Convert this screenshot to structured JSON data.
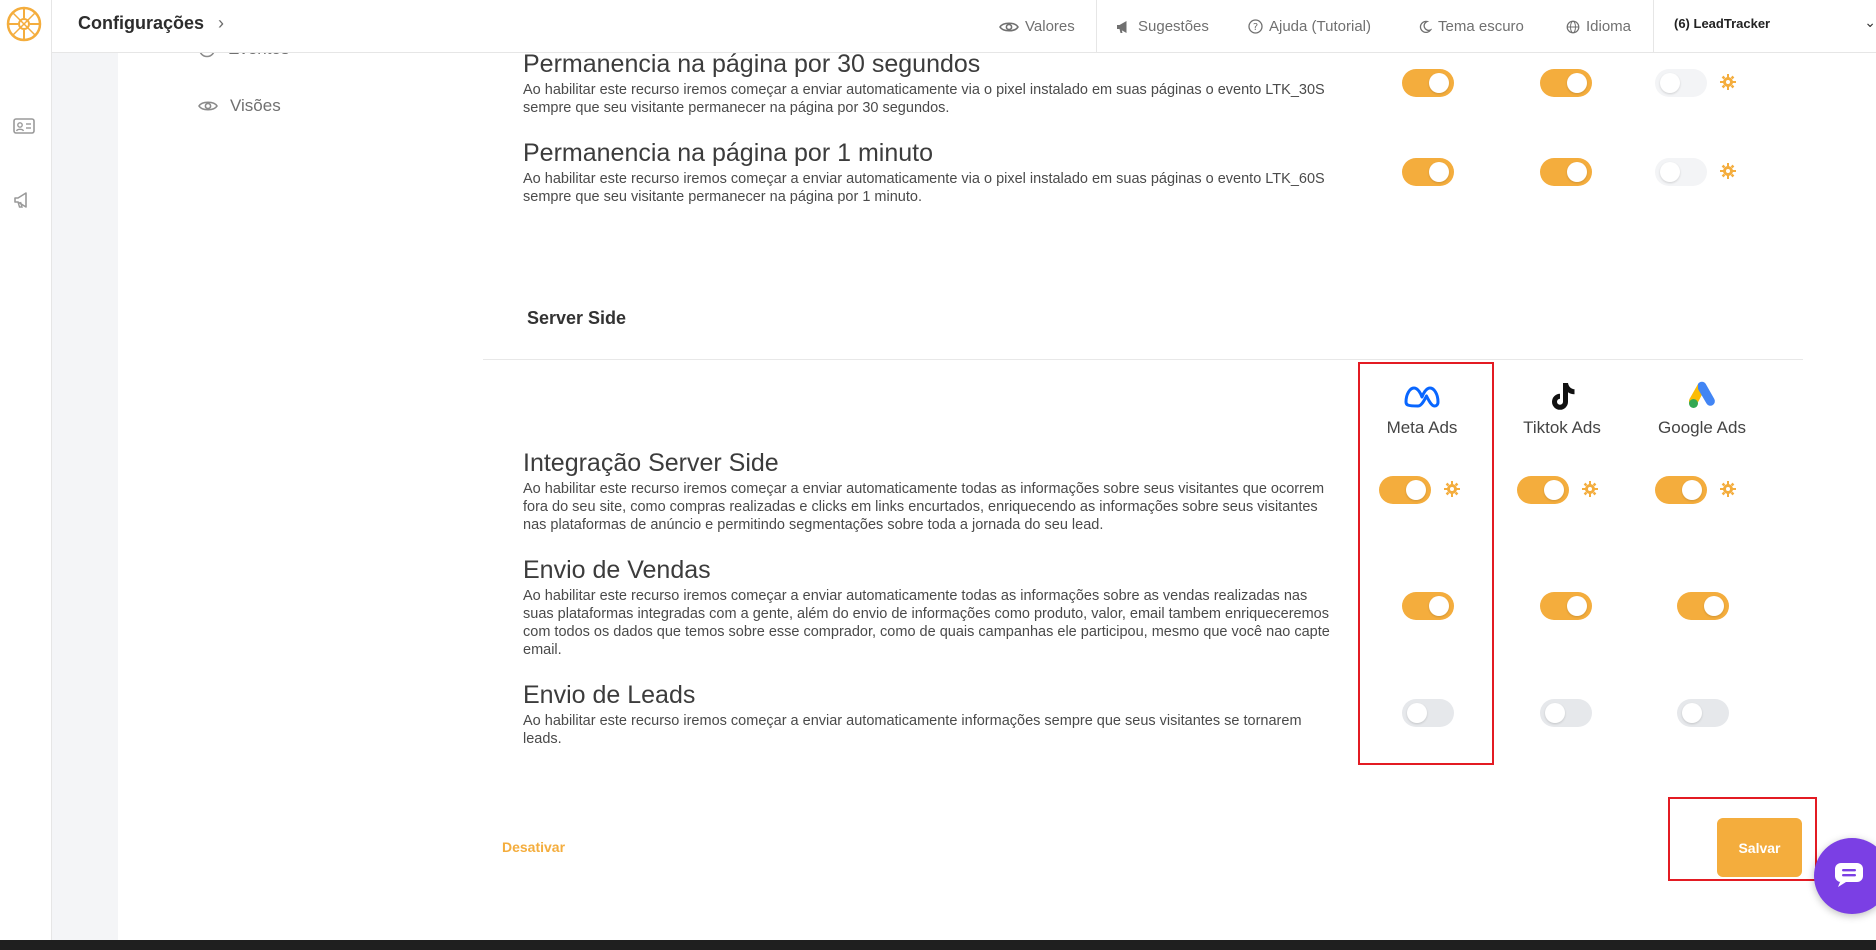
{
  "header": {
    "title": "Configurações",
    "nav": [
      {
        "label": "Valores",
        "icon": "eye-icon"
      },
      {
        "label": "Sugestões",
        "icon": "megaphone-icon"
      },
      {
        "label": "Ajuda (Tutorial)",
        "icon": "help-circle-icon"
      },
      {
        "label": "Tema escuro",
        "icon": "moon-icon"
      },
      {
        "label": "Idioma",
        "icon": "globe-icon"
      }
    ],
    "account": "(6) LeadTracker"
  },
  "sidenav": {
    "items": [
      {
        "label": "Eventos",
        "icon": "clock-icon"
      },
      {
        "label": "Visões",
        "icon": "eye-icon"
      }
    ]
  },
  "client_side": {
    "features": [
      {
        "title": "Permanencia na página por 30 segundos",
        "description": "Ao habilitar este recurso iremos começar a enviar automaticamente via o pixel instalado em suas páginas o evento LTK_30S sempre que seu visitante permanecer na página por 30 segundos.",
        "toggles": [
          "on",
          "on",
          "faint"
        ]
      },
      {
        "title": "Permanencia na página por 1 minuto",
        "description": "Ao habilitar este recurso iremos começar a enviar automaticamente via o pixel instalado em suas páginas o evento LTK_60S sempre que seu visitante permanecer na página por 1 minuto.",
        "toggles": [
          "on",
          "on",
          "faint"
        ]
      }
    ]
  },
  "server_side": {
    "label": "Server Side",
    "platforms": [
      {
        "name": "Meta Ads",
        "icon": "meta-logo-icon"
      },
      {
        "name": "Tiktok Ads",
        "icon": "tiktok-logo-icon"
      },
      {
        "name": "Google Ads",
        "icon": "google-ads-logo-icon"
      }
    ],
    "features": [
      {
        "title": "Integração Server Side",
        "description": "Ao habilitar este recurso iremos começar a enviar automaticamente todas as informações sobre seus visitantes que ocorrem fora do seu site, como compras realizadas e clicks em links encurtados, enriquecendo as informações sobre seus visitantes nas plataformas de anúncio e permitindo segmentações sobre toda a jornada do seu lead.",
        "toggles": [
          "on",
          "on",
          "on"
        ],
        "has_gear": true
      },
      {
        "title": "Envio de Vendas",
        "description": "Ao habilitar este recurso iremos começar a enviar automaticamente todas as informações sobre as vendas realizadas nas suas plataformas integradas com a gente, além do envio de informações como produto, valor, email tambem enriqueceremos com todos os dados que temos sobre esse comprador, como de quais campanhas ele participou, mesmo que você nao capte email.",
        "toggles": [
          "on",
          "on",
          "on"
        ],
        "has_gear": false
      },
      {
        "title": "Envio de Leads",
        "description": "Ao habilitar este recurso iremos começar a enviar automaticamente informações sempre que seus visitantes se tornarem leads.",
        "toggles": [
          "off",
          "off",
          "off"
        ],
        "has_gear": false
      }
    ]
  },
  "actions": {
    "deactivate_label": "Desativar",
    "save_label": "Salvar"
  },
  "colors": {
    "accent": "#f4ad3d",
    "highlight_box": "#e31b23",
    "chat": "#7b3fe4"
  }
}
